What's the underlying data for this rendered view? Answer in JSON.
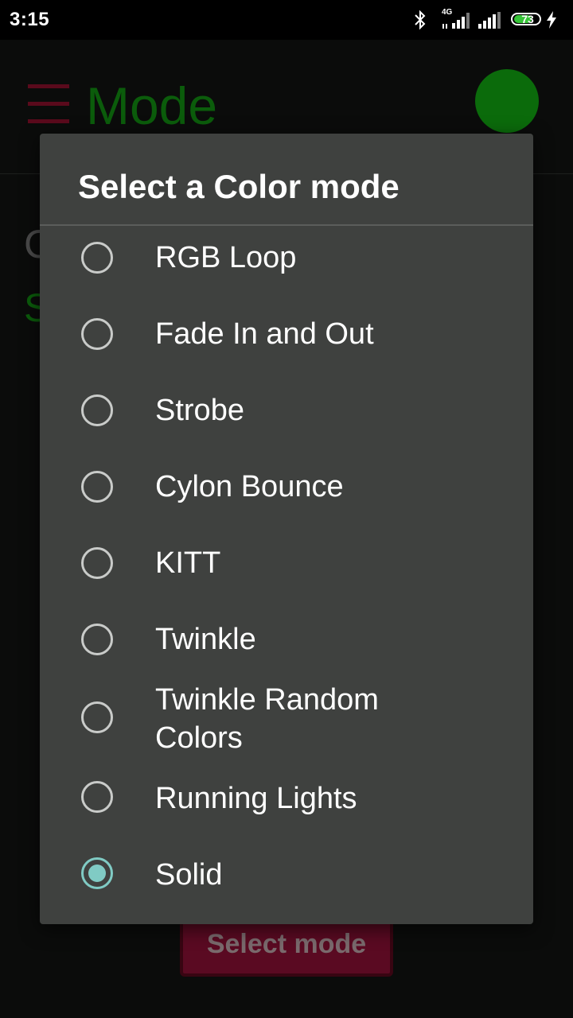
{
  "status_bar": {
    "time": "3:15",
    "network": "4G",
    "battery": "73",
    "battery_level": 0.73,
    "icons": [
      "bluetooth-icon",
      "signal-icon",
      "signal-icon",
      "battery-icon",
      "charging-icon"
    ]
  },
  "app": {
    "title": "Mode",
    "partial_line_1": "C",
    "partial_line_2": "S",
    "select_button": "Select mode",
    "accent_color": "#0b6b0b",
    "menu_color": "#5a0a1c"
  },
  "dialog": {
    "title": "Select a Color mode",
    "selected": "Solid",
    "selected_color": "#80cbc4",
    "options": [
      {
        "label": "RGB Loop",
        "checked": false
      },
      {
        "label": "Fade In and Out",
        "checked": false
      },
      {
        "label": "Strobe",
        "checked": false
      },
      {
        "label": "Cylon Bounce",
        "checked": false
      },
      {
        "label": "KITT",
        "checked": false
      },
      {
        "label": "Twinkle",
        "checked": false
      },
      {
        "label": "Twinkle Random Colors",
        "checked": false
      },
      {
        "label": "Running Lights",
        "checked": false
      },
      {
        "label": "Solid",
        "checked": true
      }
    ]
  }
}
